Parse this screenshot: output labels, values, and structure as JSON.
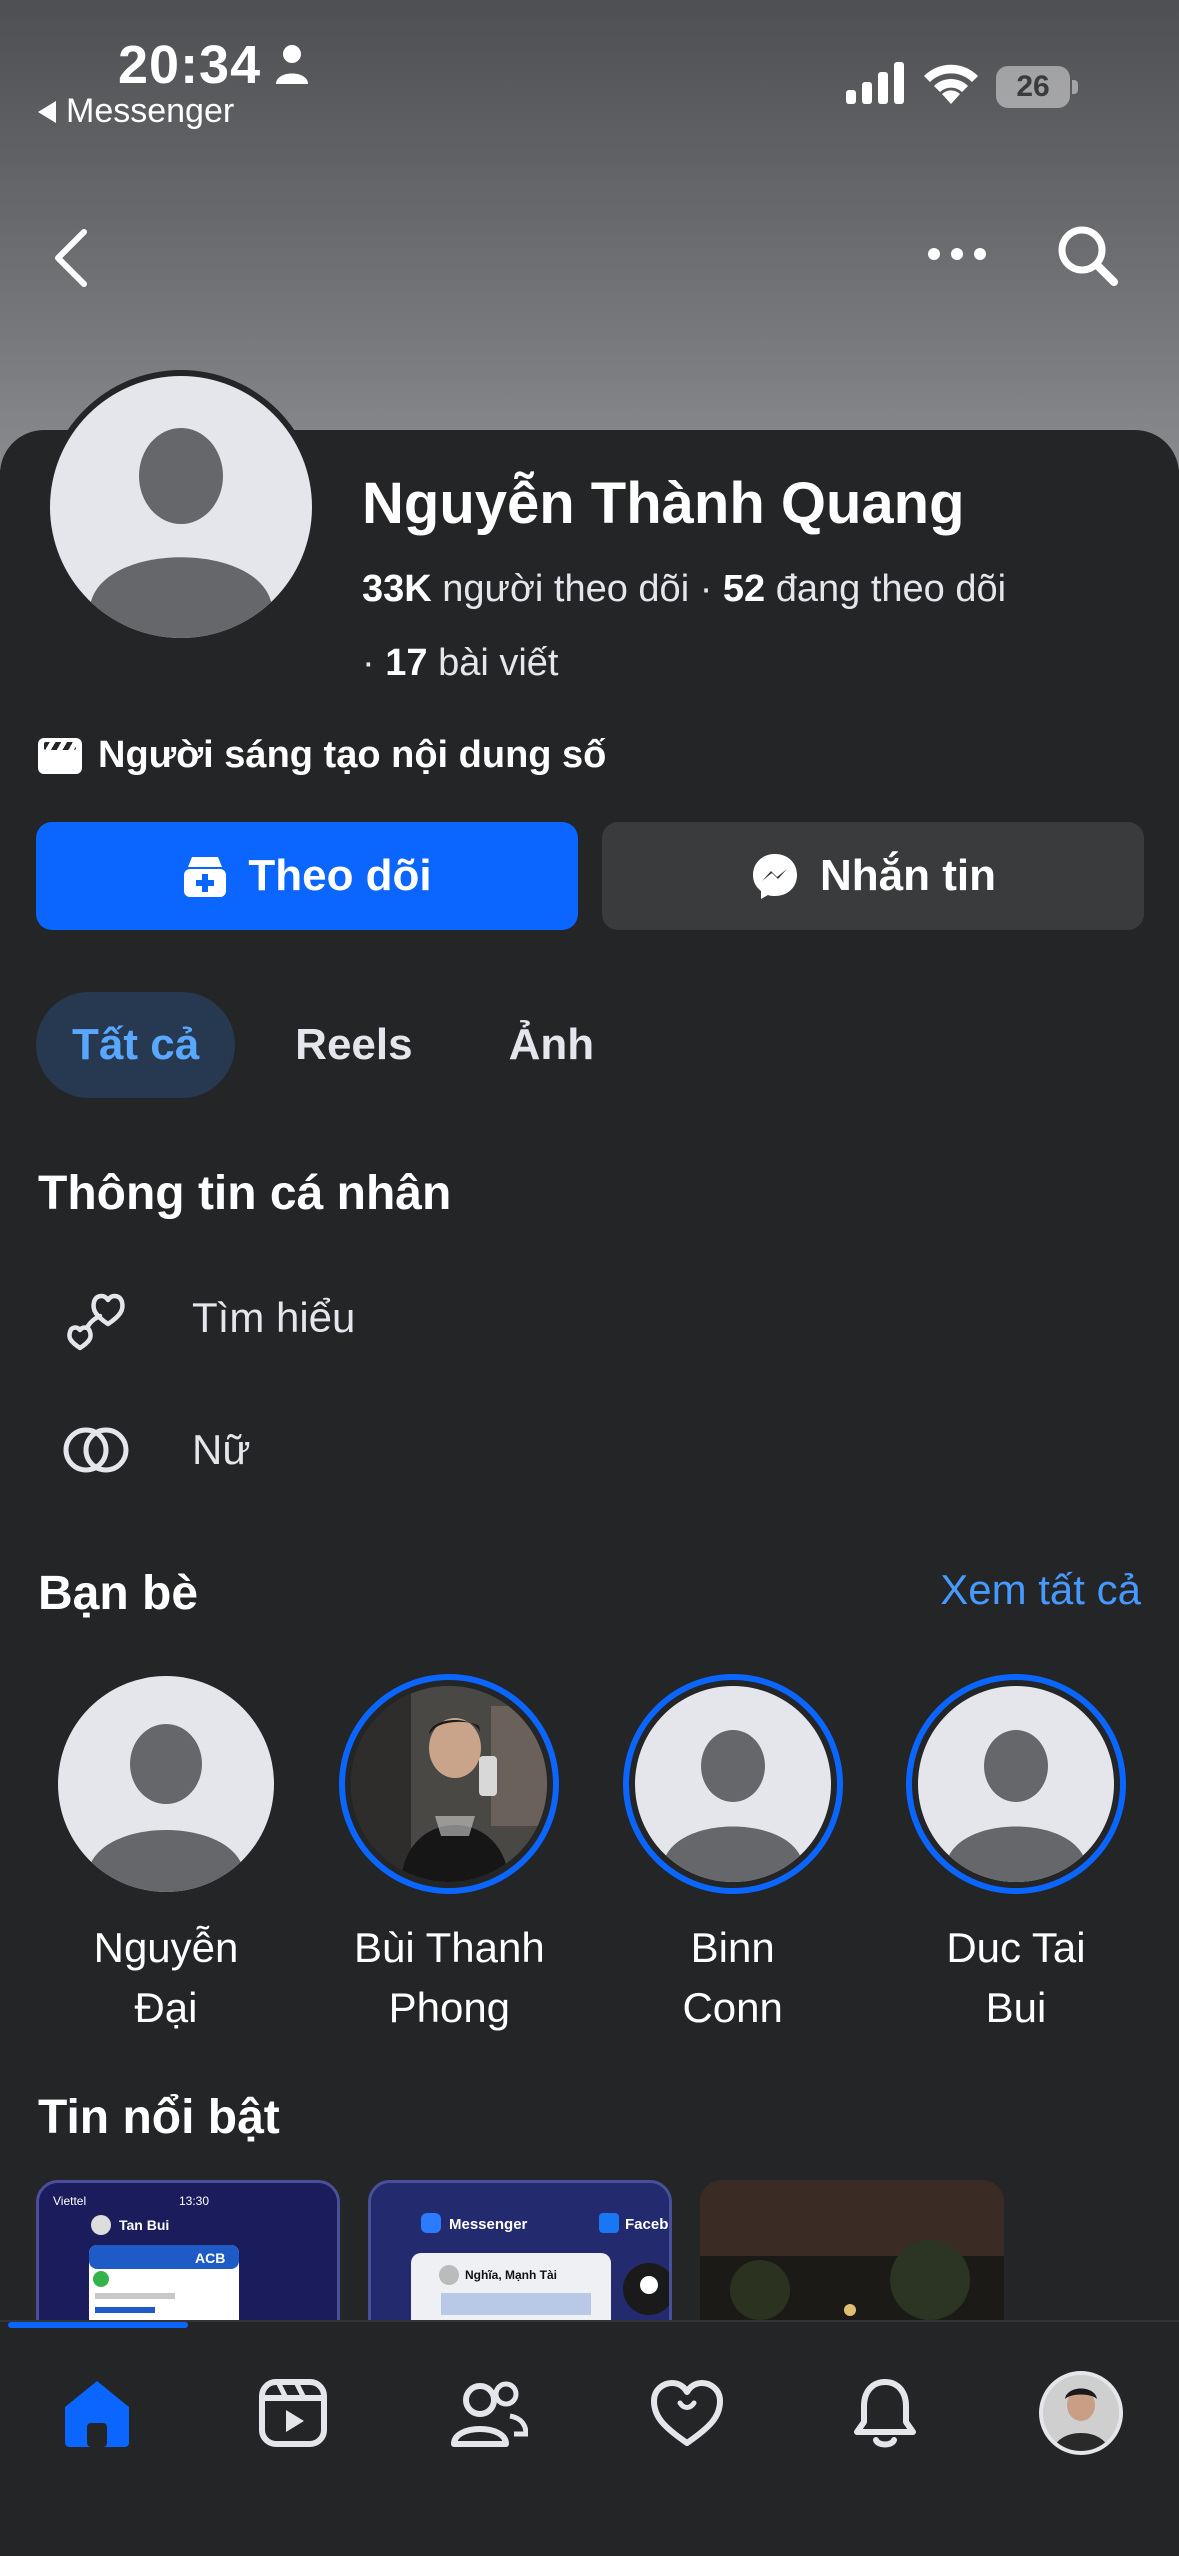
{
  "status_bar": {
    "time": "20:34",
    "back_app": "Messenger",
    "battery": "26"
  },
  "profile": {
    "name": "Nguyễn Thành Quang",
    "followers_count": "33K",
    "followers_label": "người theo dõi",
    "following_count": "52",
    "following_label": "đang theo dõi",
    "posts_count": "17",
    "posts_label": "bài viết",
    "category": "Người sáng tạo nội dung số"
  },
  "actions": {
    "follow_label": "Theo dõi",
    "message_label": "Nhắn tin"
  },
  "tabs": [
    {
      "label": "Tất cả",
      "active": true
    },
    {
      "label": "Reels",
      "active": false
    },
    {
      "label": "Ảnh",
      "active": false
    }
  ],
  "personal_info": {
    "title": "Thông tin cá nhân",
    "items": [
      {
        "icon": "hearts-icon",
        "label": "Tìm hiểu"
      },
      {
        "icon": "gender-rings-icon",
        "label": "Nữ"
      }
    ]
  },
  "friends": {
    "title": "Bạn bè",
    "see_all": "Xem tất cả",
    "items": [
      {
        "name_line1": "Nguyễn",
        "name_line2": "Đại",
        "has_story": false,
        "has_photo": false
      },
      {
        "name_line1": "Bùi Thanh",
        "name_line2": "Phong",
        "has_story": true,
        "has_photo": true
      },
      {
        "name_line1": "Binn",
        "name_line2": "Conn",
        "has_story": true,
        "has_photo": false
      },
      {
        "name_line1": "Duc Tai",
        "name_line2": "Bui",
        "has_story": true,
        "has_photo": false
      }
    ]
  },
  "highlights": {
    "title": "Tin nổi bật",
    "items": [
      {
        "preview_top": "Viettel",
        "preview_time": "13:30",
        "preview_name": "Tan Bui",
        "preview_brand": "ACB"
      },
      {
        "preview_app": "Messenger",
        "preview_name": "Nghĩa, Mạnh Tài",
        "preview_extra": "Faceb"
      },
      {
        "preview_app": ""
      }
    ]
  },
  "bottom_nav": [
    {
      "icon": "home-icon",
      "active": true
    },
    {
      "icon": "video-icon",
      "active": false
    },
    {
      "icon": "friends-icon",
      "active": false
    },
    {
      "icon": "dating-heart-icon",
      "active": false
    },
    {
      "icon": "bell-icon",
      "active": false
    },
    {
      "icon": "profile-avatar-icon",
      "active": false
    }
  ],
  "colors": {
    "accent": "#0a66ff",
    "background": "#242527",
    "link": "#4599ff",
    "tab_active_bg": "#263951"
  }
}
